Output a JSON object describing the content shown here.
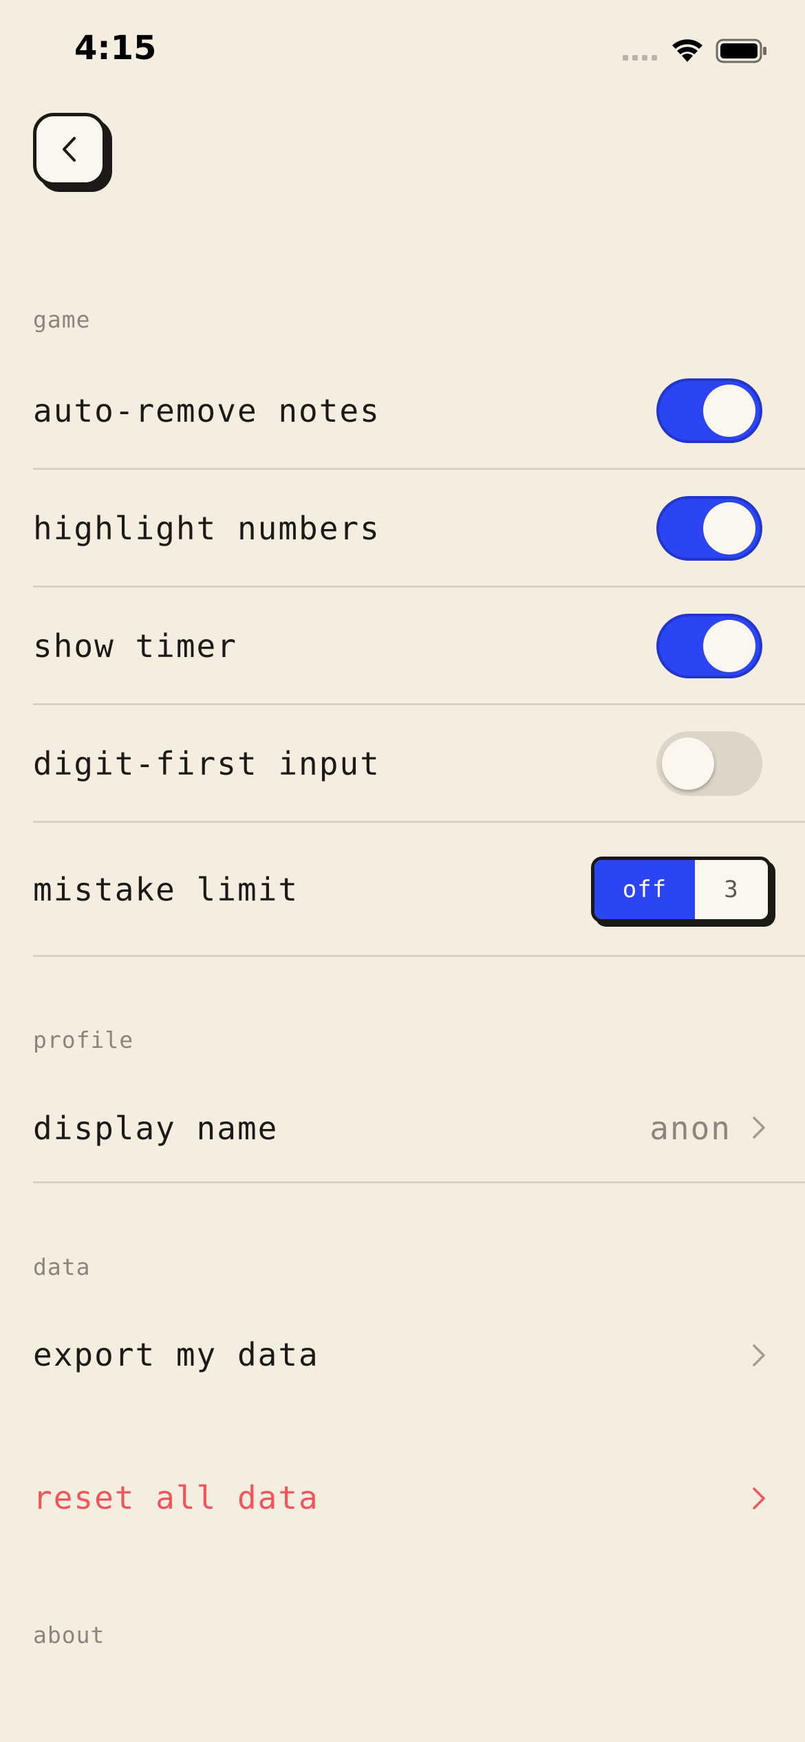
{
  "status_bar": {
    "time": "4:15",
    "icons": [
      "signal-icon",
      "wifi-icon",
      "battery-icon"
    ]
  },
  "nav": {
    "back_icon": "chevron-left-icon"
  },
  "sections": {
    "game": {
      "label": "game",
      "items": [
        {
          "label": "auto-remove notes",
          "control": "toggle",
          "on": true
        },
        {
          "label": "highlight numbers",
          "control": "toggle",
          "on": true
        },
        {
          "label": "show timer",
          "control": "toggle",
          "on": true
        },
        {
          "label": "digit-first input",
          "control": "toggle",
          "on": false
        }
      ],
      "mistake_limit": {
        "label": "mistake limit",
        "options": [
          "off",
          "3"
        ],
        "selected": "off"
      }
    },
    "profile": {
      "label": "profile",
      "display_name": {
        "label": "display name",
        "value": "anon"
      }
    },
    "data": {
      "label": "data",
      "export": {
        "label": "export my data"
      },
      "reset": {
        "label": "reset all data"
      }
    },
    "about": {
      "label": "about"
    }
  },
  "colors": {
    "background": "#f4ede0",
    "accent": "#2b45f5",
    "danger": "#f0555a",
    "text": "#1c1a17",
    "muted": "#8c857b"
  }
}
